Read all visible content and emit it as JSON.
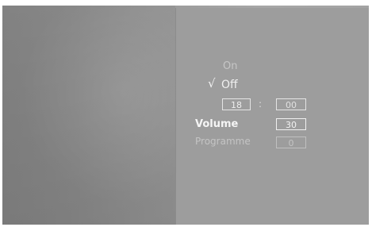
{
  "timer_menu": {
    "options": {
      "on_label": "On",
      "off_label": "Off",
      "selected_mark": "√"
    },
    "time": {
      "hour": "18",
      "separator": ":",
      "minute": "00"
    },
    "volume": {
      "label": "Volume",
      "value": "30"
    },
    "programme": {
      "label": "Programme",
      "value": "0"
    }
  },
  "colors": {
    "screen_background": "#9a9a9a",
    "panel_background": "#9d9d9d",
    "text_active": "#f0f0f0",
    "text_disabled": "#c4c4c4"
  }
}
